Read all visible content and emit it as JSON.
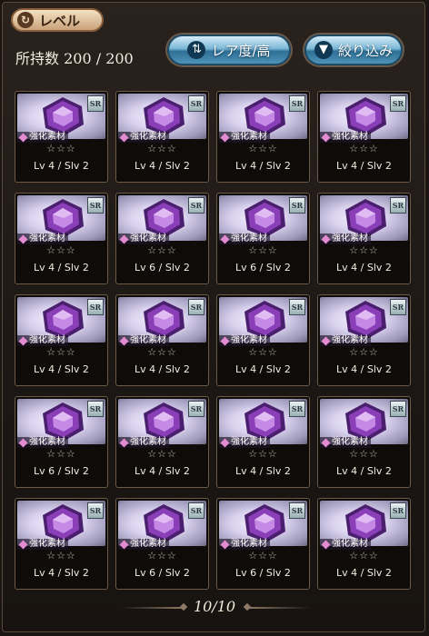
{
  "header": {
    "sort_label": "レベル",
    "sort_icon": "refresh-icon",
    "count_text": "所持数 200 / 200",
    "rarity_button": "レア度/高",
    "rarity_icon": "sort-arrows-icon",
    "filter_button": "絞り込み",
    "filter_icon": "funnel-icon"
  },
  "items": [
    {
      "rarity": "SR",
      "type": "強化素材",
      "stars": "☆☆☆",
      "level": "Lv 4 / Slv 2"
    },
    {
      "rarity": "SR",
      "type": "強化素材",
      "stars": "☆☆☆",
      "level": "Lv 4 / Slv 2"
    },
    {
      "rarity": "SR",
      "type": "強化素材",
      "stars": "☆☆☆",
      "level": "Lv 4 / Slv 2"
    },
    {
      "rarity": "SR",
      "type": "強化素材",
      "stars": "☆☆☆",
      "level": "Lv 4 / Slv 2"
    },
    {
      "rarity": "SR",
      "type": "強化素材",
      "stars": "☆☆☆",
      "level": "Lv 4 / Slv 2"
    },
    {
      "rarity": "SR",
      "type": "強化素材",
      "stars": "☆☆☆",
      "level": "Lv 6 / Slv 2"
    },
    {
      "rarity": "SR",
      "type": "強化素材",
      "stars": "☆☆☆",
      "level": "Lv 6 / Slv 2"
    },
    {
      "rarity": "SR",
      "type": "強化素材",
      "stars": "☆☆☆",
      "level": "Lv 4 / Slv 2"
    },
    {
      "rarity": "SR",
      "type": "強化素材",
      "stars": "☆☆☆",
      "level": "Lv 4 / Slv 2"
    },
    {
      "rarity": "SR",
      "type": "強化素材",
      "stars": "☆☆☆",
      "level": "Lv 4 / Slv 2"
    },
    {
      "rarity": "SR",
      "type": "強化素材",
      "stars": "☆☆☆",
      "level": "Lv 4 / Slv 2"
    },
    {
      "rarity": "SR",
      "type": "強化素材",
      "stars": "☆☆☆",
      "level": "Lv 4 / Slv 2"
    },
    {
      "rarity": "SR",
      "type": "強化素材",
      "stars": "☆☆☆",
      "level": "Lv 6 / Slv 2"
    },
    {
      "rarity": "SR",
      "type": "強化素材",
      "stars": "☆☆☆",
      "level": "Lv 4 / Slv 2"
    },
    {
      "rarity": "SR",
      "type": "強化素材",
      "stars": "☆☆☆",
      "level": "Lv 4 / Slv 2"
    },
    {
      "rarity": "SR",
      "type": "強化素材",
      "stars": "☆☆☆",
      "level": "Lv 4 / Slv 2"
    },
    {
      "rarity": "SR",
      "type": "強化素材",
      "stars": "☆☆☆",
      "level": "Lv 4 / Slv 2"
    },
    {
      "rarity": "SR",
      "type": "強化素材",
      "stars": "☆☆☆",
      "level": "Lv 6 / Slv 2"
    },
    {
      "rarity": "SR",
      "type": "強化素材",
      "stars": "☆☆☆",
      "level": "Lv 6 / Slv 2"
    },
    {
      "rarity": "SR",
      "type": "強化素材",
      "stars": "☆☆☆",
      "level": "Lv 4 / Slv 2"
    }
  ],
  "pagination": {
    "text": "10/10"
  },
  "colors": {
    "gem": "#8a3fb8",
    "gem_light": "#c58ae6",
    "gem_dark": "#4a1f6e",
    "frame": "#6b5a48"
  }
}
